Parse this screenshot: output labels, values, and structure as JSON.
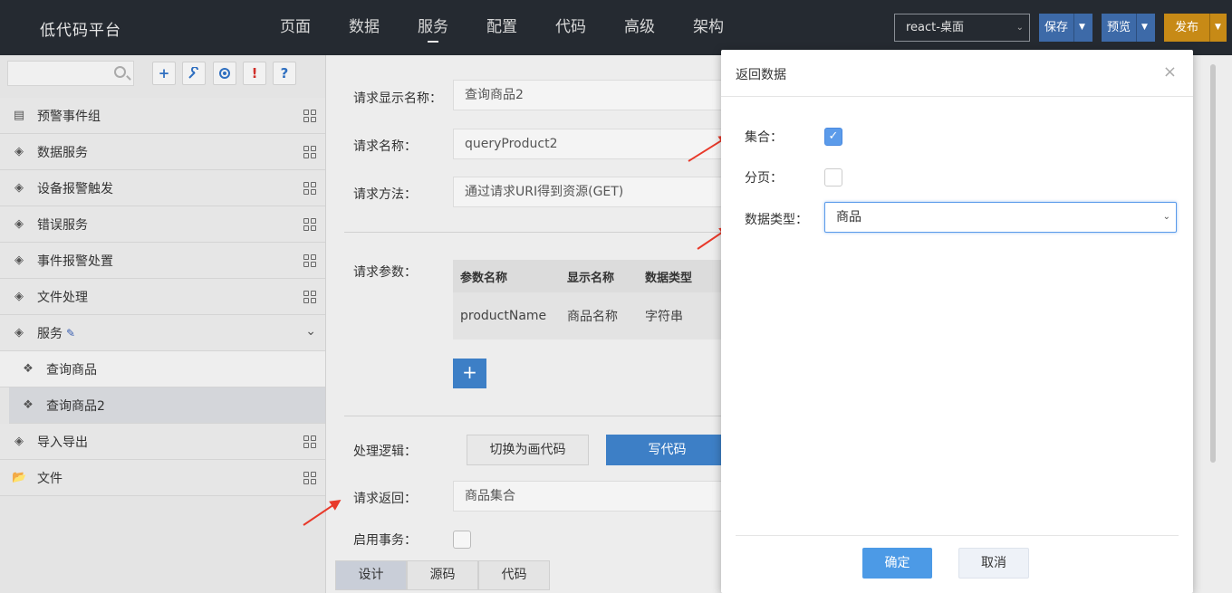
{
  "header": {
    "brand": "低代码平台",
    "nav": [
      "页面",
      "数据",
      "服务",
      "配置",
      "代码",
      "高级",
      "架构"
    ],
    "active_nav": "服务",
    "env_select": "react-桌面",
    "save": "保存",
    "preview": "预览",
    "publish": "发布"
  },
  "sidebar": {
    "search_placeholder": "",
    "tools": [
      "+",
      "wrench-icon",
      "settings-icon",
      "!",
      "?"
    ],
    "items": [
      {
        "label": "预警事件组",
        "icon": "list-icon"
      },
      {
        "label": "数据服务",
        "icon": "layers-icon"
      },
      {
        "label": "设备报警触发",
        "icon": "layers-icon"
      },
      {
        "label": "错误服务",
        "icon": "layers-icon"
      },
      {
        "label": "事件报警处置",
        "icon": "layers-icon"
      },
      {
        "label": "文件处理",
        "icon": "layers-icon"
      },
      {
        "label": "服务",
        "icon": "layers-icon"
      },
      {
        "label": "查询商品",
        "icon": "grid-icon"
      },
      {
        "label": "查询商品2",
        "icon": "grid-icon"
      },
      {
        "label": "导入导出",
        "icon": "layers-icon"
      },
      {
        "label": "文件",
        "icon": "folder-icon"
      }
    ]
  },
  "form": {
    "display_name_label": "请求显示名称：",
    "display_name_value": "查询商品2",
    "name_label": "请求名称：",
    "name_value": "queryProduct2",
    "method_label": "请求方法：",
    "method_value": "通过请求URI得到资源(GET)",
    "params_label": "请求参数：",
    "params_headers": [
      "参数名称",
      "显示名称",
      "数据类型"
    ],
    "params_rows": [
      [
        "productName",
        "商品名称",
        "字符串"
      ]
    ],
    "logic_label": "处理逻辑：",
    "switch_btn": "切换为画代码",
    "write_btn": "写代码",
    "return_label": "请求返回：",
    "return_value": "商品集合",
    "tx_label": "启用事务：",
    "tabs": [
      "设计",
      "源码",
      "代码"
    ]
  },
  "modal": {
    "title": "返回数据",
    "close": "×",
    "collection_label": "集合：",
    "collection_checked": true,
    "paging_label": "分页：",
    "paging_checked": false,
    "type_label": "数据类型：",
    "type_value": "商品",
    "ok": "确定",
    "cancel": "取消"
  },
  "colors": {
    "topbar": "#252a31",
    "primary": "#3d7fc6",
    "publish": "#c78a16",
    "arrow": "#e8392a"
  }
}
